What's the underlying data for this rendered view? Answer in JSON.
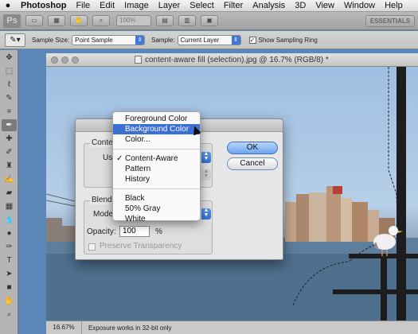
{
  "menubar": {
    "app": "Photoshop",
    "items": [
      "File",
      "Edit",
      "Image",
      "Layer",
      "Select",
      "Filter",
      "Analysis",
      "3D",
      "View",
      "Window",
      "Help"
    ]
  },
  "appbar": {
    "logo": "Ps",
    "zoom": "100%",
    "workspace": "ESSENTIALS"
  },
  "options": {
    "sample_size_label": "Sample Size:",
    "sample_size_value": "Point Sample",
    "sample_label": "Sample:",
    "sample_value": "Current Layer",
    "show_ring_label": "Show Sampling Ring",
    "show_ring_checked": "✓"
  },
  "document": {
    "title": "content-aware fill (selection).jpg @ 16.7% (RGB/8) *",
    "zoom": "16.67%",
    "status": "Exposure works in 32-bit only"
  },
  "dialog": {
    "contents_group": "Conte",
    "use_label": "Us",
    "blending_group": "Blend",
    "mode_label": "Mode",
    "opacity_label": "Opacity:",
    "opacity_value": "100",
    "opacity_unit": "%",
    "preserve_label": "Preserve Transparency",
    "ok_label": "OK",
    "cancel_label": "Cancel"
  },
  "popup": {
    "group1": [
      "Foreground Color",
      "Background Color",
      "Color..."
    ],
    "group2": [
      "Content-Aware",
      "Pattern",
      "History"
    ],
    "group3": [
      "Black",
      "50% Gray",
      "White"
    ],
    "selected": "Background Color",
    "checked": "Content-Aware"
  },
  "tools": [
    "move-tool",
    "marquee-tool",
    "lasso-tool",
    "quick-selection-tool",
    "crop-tool",
    "eyedropper-tool",
    "spot-healing-tool",
    "brush-tool",
    "clone-stamp-tool",
    "history-brush-tool",
    "eraser-tool",
    "gradient-tool",
    "blur-tool",
    "dodge-tool",
    "pen-tool",
    "type-tool",
    "path-selection-tool",
    "shape-tool",
    "hand-tool",
    "zoom-tool"
  ],
  "colors": {
    "selection_blue": "#3a6fd6",
    "desktop_blue": "#5a86b8"
  }
}
